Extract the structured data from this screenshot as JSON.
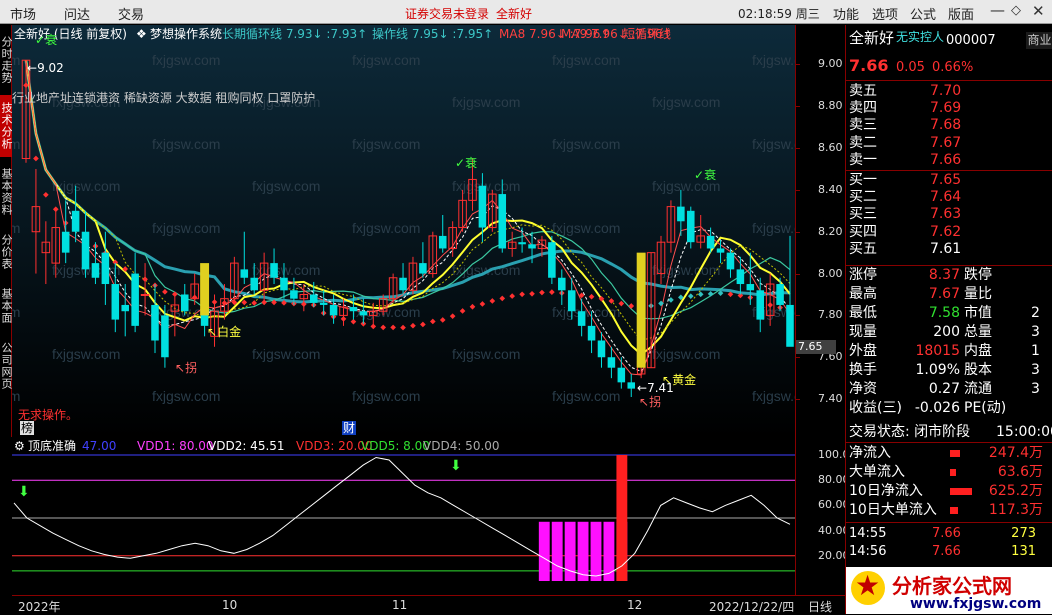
{
  "menu": {
    "items": [
      "市场",
      "问达",
      "交易"
    ],
    "warning": "证券交易未登录",
    "stock_name": "全新好",
    "clock": "02:18:59 周三",
    "right_items": [
      "功能",
      "选项",
      "公式",
      "版面"
    ]
  },
  "side_tabs": [
    "分时走势",
    "技术分析",
    "基本资料",
    "分价表",
    "基本面",
    "公司网页"
  ],
  "main_legend": {
    "title": "全新好 (日线 前复权)",
    "system": "梦想操作系统",
    "items": [
      {
        "label": "长期循环线",
        "value": "7.93",
        "value2": "7.93",
        "color": "#3cc8c8"
      },
      {
        "label": "操作线",
        "value": "7.95",
        "value2": "7.95",
        "color": "#3cc8c8"
      },
      {
        "label": "MA8",
        "value": "7.96",
        "value2": "7.96",
        "color": "#ff4040"
      },
      {
        "label": "MA9",
        "value": "7.96",
        "value2": "7.96",
        "color": "#ff4040"
      },
      {
        "label": "短循环线",
        "value": "",
        "value2": "",
        "color": "#ff4040"
      }
    ]
  },
  "concepts": "行业地产址连锁港资 稀缺资源 大数据 租购同权 口罩防护",
  "annotations": {
    "high": "9.02",
    "decline1": "衰",
    "decline2": "衰",
    "decline3": "衰",
    "baijin": "白金",
    "guai1": "拐",
    "guai2": "拐",
    "huangjin": "黄金",
    "low": "7.41",
    "no_op": "无求操作。",
    "bang": "榜",
    "cai": "财"
  },
  "y_ticks": [
    "9.00",
    "8.80",
    "8.60",
    "8.40",
    "8.20",
    "8.00",
    "7.80",
    "7.60",
    "7.40"
  ],
  "current_price_tag": "7.65",
  "ind_legend": {
    "title": "顶底准确",
    "items": [
      {
        "label": "",
        "value": "47.00",
        "color": "#4040ff"
      },
      {
        "label": "VDD1",
        "value": "80.00",
        "color": "#ff40ff"
      },
      {
        "label": "VDD2",
        "value": "45.51",
        "color": "#ffffff"
      },
      {
        "label": "VDD3",
        "value": "20.00",
        "color": "#ff3030"
      },
      {
        "label": "VDD5",
        "value": "8.00",
        "color": "#30e030"
      },
      {
        "label": "VDD4",
        "value": "50.00",
        "color": "#aaaaaa"
      }
    ]
  },
  "ind_ticks": [
    "100.0",
    "80.00",
    "60.00",
    "40.00",
    "20.00"
  ],
  "date_labels": [
    "2022年",
    "10",
    "11",
    "12",
    "2022/12/22/四",
    "日线"
  ],
  "quote": {
    "name": "全新好",
    "tag": "无实控人",
    "code": "000007",
    "side": "商业",
    "price": "7.66",
    "change": "0.05",
    "pct": "0.66%",
    "sells": [
      {
        "label": "卖五",
        "price": "7.70"
      },
      {
        "label": "卖四",
        "price": "7.69"
      },
      {
        "label": "卖三",
        "price": "7.68"
      },
      {
        "label": "卖二",
        "price": "7.67"
      },
      {
        "label": "卖一",
        "price": "7.66"
      }
    ],
    "buys": [
      {
        "label": "买一",
        "price": "7.65"
      },
      {
        "label": "买二",
        "price": "7.64"
      },
      {
        "label": "买三",
        "price": "7.63"
      },
      {
        "label": "买四",
        "price": "7.62"
      },
      {
        "label": "买五",
        "price": "7.61"
      }
    ],
    "stats": [
      {
        "l1": "涨停",
        "v1": "8.37",
        "c1": "#ff3030",
        "l2": "跌停",
        "v2": ""
      },
      {
        "l1": "最高",
        "v1": "7.67",
        "c1": "#ff3030",
        "l2": "量比",
        "v2": ""
      },
      {
        "l1": "最低",
        "v1": "7.58",
        "c1": "#30e030",
        "l2": "市值",
        "v2": "2"
      },
      {
        "l1": "现量",
        "v1": "200",
        "c1": "#ffffff",
        "l2": "总量",
        "v2": "3"
      },
      {
        "l1": "外盘",
        "v1": "18015",
        "c1": "#ff3030",
        "l2": "内盘",
        "v2": "1"
      },
      {
        "l1": "换手",
        "v1": "1.09%",
        "c1": "#ffffff",
        "l2": "股本",
        "v2": "3"
      },
      {
        "l1": "净资",
        "v1": "0.27",
        "c1": "#ffffff",
        "l2": "流通",
        "v2": "3"
      },
      {
        "l1": "收益(三)",
        "v1": "-0.026",
        "c1": "#ffffff",
        "l2": "PE(动)",
        "v2": ""
      }
    ],
    "trade_state": "交易状态: 闭市阶段",
    "trade_time": "15:00:00",
    "flows": [
      {
        "label": "净流入",
        "value": "247.4万"
      },
      {
        "label": "大单流入",
        "value": "63.6万"
      },
      {
        "label": "10日净流入",
        "value": "625.2万"
      },
      {
        "label": "10日大单流入",
        "value": "117.3万"
      }
    ],
    "ticks": [
      {
        "time": "14:55",
        "price": "7.66",
        "vol": "273"
      },
      {
        "time": "14:56",
        "price": "7.66",
        "vol": "131"
      }
    ]
  },
  "watermark": "fxjgsw.com",
  "logo": {
    "main": "分析家公式网",
    "url": "www.fxjgsw.com"
  },
  "chart_data": [
    {
      "type": "candlestick",
      "title": "全新好 (日线 前复权)",
      "ylim": [
        7.3,
        9.15
      ],
      "candles": [
        [
          8.55,
          9.02,
          8.53,
          9.02
        ],
        [
          8.2,
          8.5,
          8.0,
          8.32
        ],
        [
          8.1,
          8.25,
          7.95,
          8.15
        ],
        [
          8.05,
          8.3,
          7.98,
          8.22
        ],
        [
          8.2,
          8.35,
          8.05,
          8.1
        ],
        [
          8.3,
          8.42,
          8.15,
          8.2
        ],
        [
          8.2,
          8.3,
          7.98,
          8.02
        ],
        [
          8.05,
          8.15,
          7.95,
          7.98
        ],
        [
          8.1,
          8.2,
          7.85,
          7.95
        ],
        [
          7.95,
          8.05,
          7.72,
          7.78
        ],
        [
          7.85,
          7.95,
          7.7,
          7.82
        ],
        [
          8.0,
          8.1,
          7.72,
          7.75
        ],
        [
          7.9,
          8.05,
          7.8,
          7.9
        ],
        [
          7.85,
          7.95,
          7.62,
          7.68
        ],
        [
          7.8,
          7.85,
          7.55,
          7.6
        ],
        [
          7.82,
          7.9,
          7.7,
          7.85
        ],
        [
          7.9,
          7.95,
          7.8,
          7.82
        ],
        [
          7.88,
          8.0,
          7.85,
          7.95
        ],
        [
          7.9,
          7.98,
          7.7,
          7.75
        ],
        [
          7.7,
          7.9,
          7.65,
          7.82
        ],
        [
          7.82,
          7.95,
          7.78,
          7.88
        ],
        [
          7.88,
          8.08,
          7.85,
          8.05
        ],
        [
          8.02,
          8.2,
          7.95,
          7.98
        ],
        [
          7.98,
          8.05,
          7.9,
          7.92
        ],
        [
          7.92,
          8.1,
          7.85,
          8.05
        ],
        [
          8.05,
          8.12,
          7.95,
          7.98
        ],
        [
          7.98,
          8.05,
          7.88,
          7.92
        ],
        [
          7.92,
          7.98,
          7.85,
          7.88
        ],
        [
          7.88,
          7.95,
          7.82,
          7.9
        ],
        [
          7.9,
          7.96,
          7.84,
          7.86
        ],
        [
          7.86,
          7.92,
          7.8,
          7.85
        ],
        [
          7.85,
          7.9,
          7.76,
          7.8
        ],
        [
          7.8,
          7.88,
          7.75,
          7.84
        ],
        [
          7.84,
          7.9,
          7.78,
          7.82
        ],
        [
          7.82,
          7.88,
          7.76,
          7.8
        ],
        [
          7.8,
          7.86,
          7.74,
          7.82
        ],
        [
          7.82,
          7.9,
          7.8,
          7.88
        ],
        [
          7.88,
          8.0,
          7.86,
          7.98
        ],
        [
          7.98,
          8.05,
          7.9,
          7.92
        ],
        [
          7.92,
          8.08,
          7.9,
          8.05
        ],
        [
          8.05,
          8.15,
          7.98,
          8.0
        ],
        [
          8.0,
          8.2,
          7.98,
          8.18
        ],
        [
          8.18,
          8.28,
          8.1,
          8.12
        ],
        [
          8.12,
          8.25,
          8.08,
          8.22
        ],
        [
          8.22,
          8.4,
          8.2,
          8.35
        ],
        [
          8.35,
          8.55,
          8.3,
          8.45
        ],
        [
          8.42,
          8.48,
          8.15,
          8.22
        ],
        [
          8.22,
          8.4,
          8.2,
          8.38
        ],
        [
          8.38,
          8.45,
          8.1,
          8.12
        ],
        [
          8.12,
          8.2,
          8.08,
          8.15
        ],
        [
          8.15,
          8.22,
          8.1,
          8.14
        ],
        [
          8.14,
          8.2,
          8.05,
          8.12
        ],
        [
          8.12,
          8.18,
          8.08,
          8.16
        ],
        [
          8.15,
          8.18,
          7.95,
          7.98
        ],
        [
          7.98,
          8.02,
          7.85,
          7.92
        ],
        [
          7.92,
          7.98,
          7.78,
          7.82
        ],
        [
          7.82,
          7.88,
          7.7,
          7.75
        ],
        [
          7.75,
          7.82,
          7.62,
          7.68
        ],
        [
          7.68,
          7.72,
          7.55,
          7.6
        ],
        [
          7.6,
          7.65,
          7.5,
          7.55
        ],
        [
          7.55,
          7.6,
          7.45,
          7.48
        ],
        [
          7.48,
          7.52,
          7.41,
          7.45
        ],
        [
          7.52,
          7.62,
          7.5,
          7.58
        ],
        [
          7.55,
          8.1,
          7.55,
          8.1
        ],
        [
          8.0,
          8.18,
          7.95,
          8.15
        ],
        [
          8.15,
          8.35,
          8.1,
          8.32
        ],
        [
          8.32,
          8.4,
          8.18,
          8.25
        ],
        [
          8.3,
          8.32,
          8.12,
          8.15
        ],
        [
          8.15,
          8.28,
          8.12,
          8.18
        ],
        [
          8.18,
          8.22,
          8.1,
          8.12
        ],
        [
          8.12,
          8.16,
          8.05,
          8.1
        ],
        [
          8.1,
          8.12,
          7.98,
          8.02
        ],
        [
          8.02,
          8.08,
          7.9,
          7.95
        ],
        [
          7.95,
          8.1,
          7.85,
          7.92
        ],
        [
          7.92,
          7.98,
          7.72,
          7.78
        ],
        [
          7.8,
          8.0,
          7.75,
          7.95
        ],
        [
          7.95,
          7.98,
          7.82,
          7.85
        ],
        [
          7.85,
          8.18,
          7.8,
          7.65
        ]
      ],
      "x_labels": [
        "2022年",
        "10",
        "11",
        "12",
        "2022/12/22/四"
      ]
    },
    {
      "type": "line",
      "title": "顶底准确",
      "ylim": [
        0,
        105
      ],
      "series": [
        {
          "name": "VDD2",
          "values": [
            62,
            50,
            44,
            38,
            33,
            28,
            24,
            21,
            19,
            18,
            20,
            22,
            25,
            28,
            30,
            28,
            24,
            22,
            25,
            30,
            36,
            44,
            52,
            60,
            68,
            76,
            84,
            92,
            98,
            96,
            86,
            76,
            70,
            66,
            60,
            54,
            48,
            42,
            36,
            30,
            24,
            18,
            12,
            8,
            5,
            4,
            6,
            12,
            22,
            40,
            60,
            66,
            62,
            58,
            55,
            60,
            64,
            68,
            60,
            50,
            45
          ]
        }
      ],
      "bars": {
        "magenta": [
          0,
          0,
          0,
          0,
          0,
          0,
          0,
          0,
          0,
          0,
          0,
          0,
          0,
          0,
          0,
          0,
          0,
          0,
          0,
          0,
          0,
          0,
          0,
          0,
          0,
          0,
          0,
          0,
          0,
          0,
          0,
          0,
          0,
          0,
          0,
          0,
          0,
          0,
          0,
          0,
          0,
          47,
          47,
          47,
          47,
          47,
          47,
          47,
          0,
          0,
          0,
          0,
          0,
          0,
          0,
          0,
          0,
          0,
          0,
          0,
          0
        ],
        "red": [
          0,
          0,
          0,
          0,
          0,
          0,
          0,
          0,
          0,
          0,
          0,
          0,
          0,
          0,
          0,
          0,
          0,
          0,
          0,
          0,
          0,
          0,
          0,
          0,
          0,
          0,
          0,
          0,
          0,
          0,
          0,
          0,
          0,
          0,
          0,
          0,
          0,
          0,
          0,
          0,
          0,
          0,
          0,
          0,
          0,
          0,
          0,
          100,
          0,
          0,
          0,
          0,
          0,
          0,
          0,
          0,
          0,
          0,
          0,
          0,
          0
        ]
      }
    }
  ]
}
